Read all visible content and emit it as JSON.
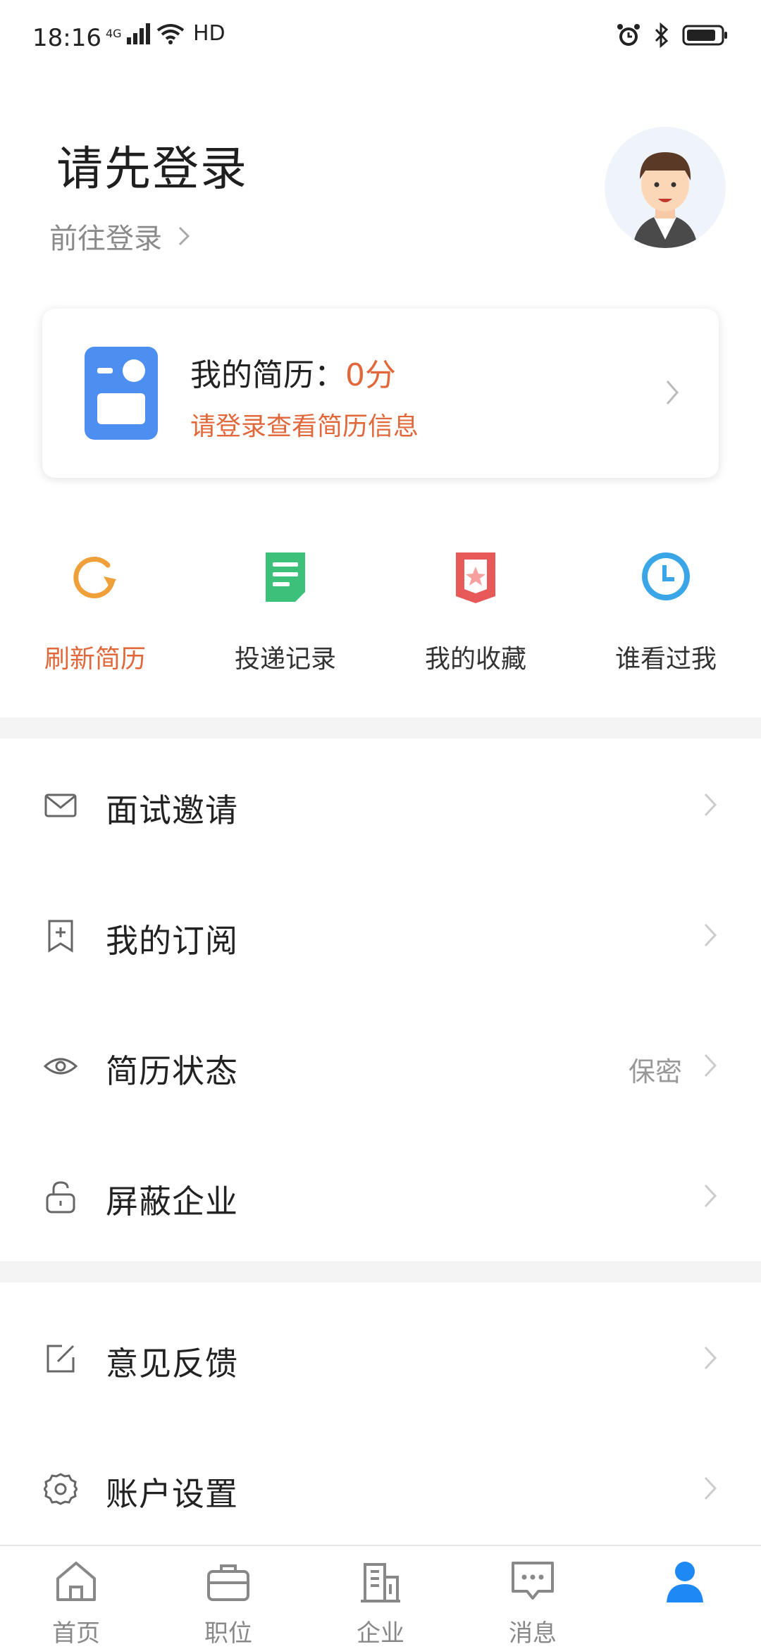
{
  "status_bar": {
    "time": "18:16",
    "network": "4G",
    "hd": "HD"
  },
  "header": {
    "title": "请先登录",
    "login_link": "前往登录"
  },
  "resume_card": {
    "title_prefix": "我的简历：",
    "score": "0分",
    "subtitle": "请登录查看简历信息"
  },
  "quick_actions": [
    {
      "label": "刷新简历",
      "icon": "refresh-icon"
    },
    {
      "label": "投递记录",
      "icon": "document-icon"
    },
    {
      "label": "我的收藏",
      "icon": "star-bookmark-icon"
    },
    {
      "label": "谁看过我",
      "icon": "clock-icon"
    }
  ],
  "menu": [
    {
      "label": "面试邀请",
      "icon": "mail-icon",
      "value": ""
    },
    {
      "label": "我的订阅",
      "icon": "bookmark-add-icon",
      "value": ""
    },
    {
      "label": "简历状态",
      "icon": "eye-icon",
      "value": "保密"
    },
    {
      "label": "屏蔽企业",
      "icon": "lock-icon",
      "value": ""
    },
    {
      "label": "意见反馈",
      "icon": "edit-icon",
      "value": ""
    },
    {
      "label": "账户设置",
      "icon": "gear-icon",
      "value": ""
    }
  ],
  "bottom_nav": [
    {
      "label": "首页",
      "icon": "home-icon"
    },
    {
      "label": "职位",
      "icon": "briefcase-icon"
    },
    {
      "label": "企业",
      "icon": "building-icon"
    },
    {
      "label": "消息",
      "icon": "message-icon"
    },
    {
      "label": "",
      "icon": "person-icon"
    }
  ],
  "colors": {
    "accent_orange": "#e0683a",
    "accent_blue": "#1e88f5",
    "resume_icon_blue": "#4c8ff0",
    "doc_green": "#3cc07a",
    "star_red": "#e85a5a",
    "clock_blue": "#3aa6e8"
  }
}
